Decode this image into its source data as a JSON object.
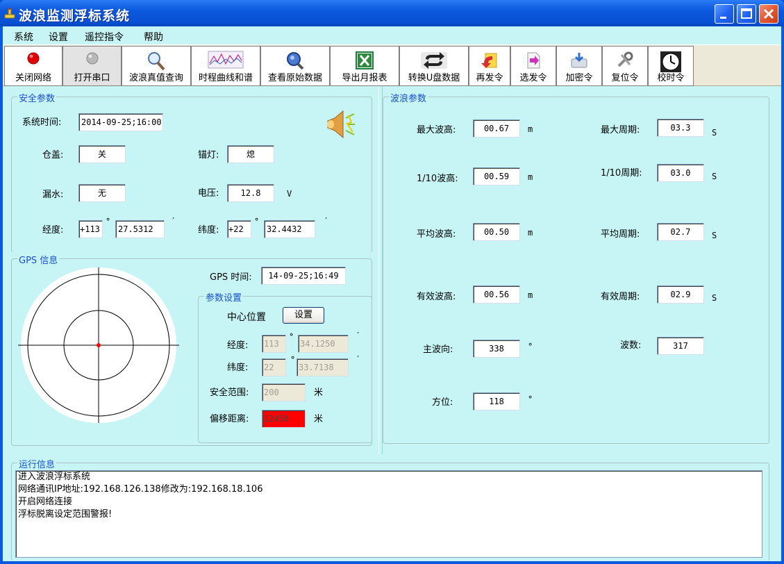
{
  "window": {
    "title": "波浪监测浮标系统"
  },
  "menu": [
    "系统",
    "设置",
    "遥控指令",
    "帮助"
  ],
  "toolbar": [
    {
      "label": "关闭网络",
      "icon": "red-dot-icon"
    },
    {
      "label": "打开串口",
      "icon": "gray-dot-icon"
    },
    {
      "label": "波浪真值查询",
      "icon": "magnifier-icon"
    },
    {
      "label": "时程曲线和谱",
      "icon": "chart-icon"
    },
    {
      "label": "查看原始数据",
      "icon": "search-globe-icon"
    },
    {
      "label": "导出月报表",
      "icon": "excel-icon"
    },
    {
      "label": "转换U盘数据",
      "icon": "convert-arrows-icon"
    },
    {
      "label": "再发令",
      "icon": "resend-icon"
    },
    {
      "label": "选发令",
      "icon": "select-send-icon"
    },
    {
      "label": "加密令",
      "icon": "encrypt-icon"
    },
    {
      "label": "复位令",
      "icon": "reset-icon"
    },
    {
      "label": "校时令",
      "icon": "clock-icon"
    }
  ],
  "safety": {
    "legend": "安全参数",
    "sys_time_label": "系统时间:",
    "sys_time": "2014-09-25;16:00",
    "hatch_label": "仓盖:",
    "hatch": "关",
    "anchor_light_label": "锚灯:",
    "anchor_light": "熄",
    "leak_label": "漏水:",
    "leak": "无",
    "voltage_label": "电压:",
    "voltage": "12.8",
    "voltage_unit": "V",
    "lon_label": "经度:",
    "lon_deg": "+113",
    "lon_min": "27.5312",
    "lat_label": "纬度:",
    "lat_deg": "+22",
    "lat_min": "32.4432",
    "deg_sym": "°",
    "min_sym": "′"
  },
  "gps": {
    "legend": "GPS 信息",
    "time_label": "GPS 时间:",
    "time": "14-09-25;16:49"
  },
  "params": {
    "legend": "参数设置",
    "center_label": "中心位置",
    "set_button": "设置",
    "lon_label": "经度:",
    "lon_deg": "113",
    "lon_min": "34.1250",
    "lat_label": "纬度:",
    "lat_deg": "22",
    "lat_min": "33.7138",
    "range_label": "安全范围:",
    "range": "200",
    "range_unit": "米",
    "offset_label": "偏移距离:",
    "offset": "12458",
    "offset_unit": "米"
  },
  "wave": {
    "legend": "波浪参数",
    "max_h_label": "最大波高:",
    "max_h": "00.67",
    "max_h_unit": "m",
    "max_t_label": "最大周期:",
    "max_t": "03.3",
    "max_t_unit": "S",
    "h10_label": "1/10波高:",
    "h10": "00.59",
    "h10_unit": "m",
    "t10_label": "1/10周期:",
    "t10": "03.0",
    "t10_unit": "S",
    "avg_h_label": "平均波高:",
    "avg_h": "00.50",
    "avg_h_unit": "m",
    "avg_t_label": "平均周期:",
    "avg_t": "02.7",
    "avg_t_unit": "S",
    "sig_h_label": "有效波高:",
    "sig_h": "00.56",
    "sig_h_unit": "m",
    "sig_t_label": "有效周期:",
    "sig_t": "02.9",
    "sig_t_unit": "S",
    "dir_label": "主波向:",
    "dir": "338",
    "dir_unit": "°",
    "count_label": "波数:",
    "count": "317",
    "az_label": "方位:",
    "az": "118",
    "az_unit": "°"
  },
  "log": {
    "legend": "运行信息",
    "lines": [
      "进入波浪浮标系统",
      "网络通讯IP地址:192.168.126.138修改为:192.168.18.106",
      "开启网络连接",
      "浮标脱离设定范围警报!"
    ]
  }
}
